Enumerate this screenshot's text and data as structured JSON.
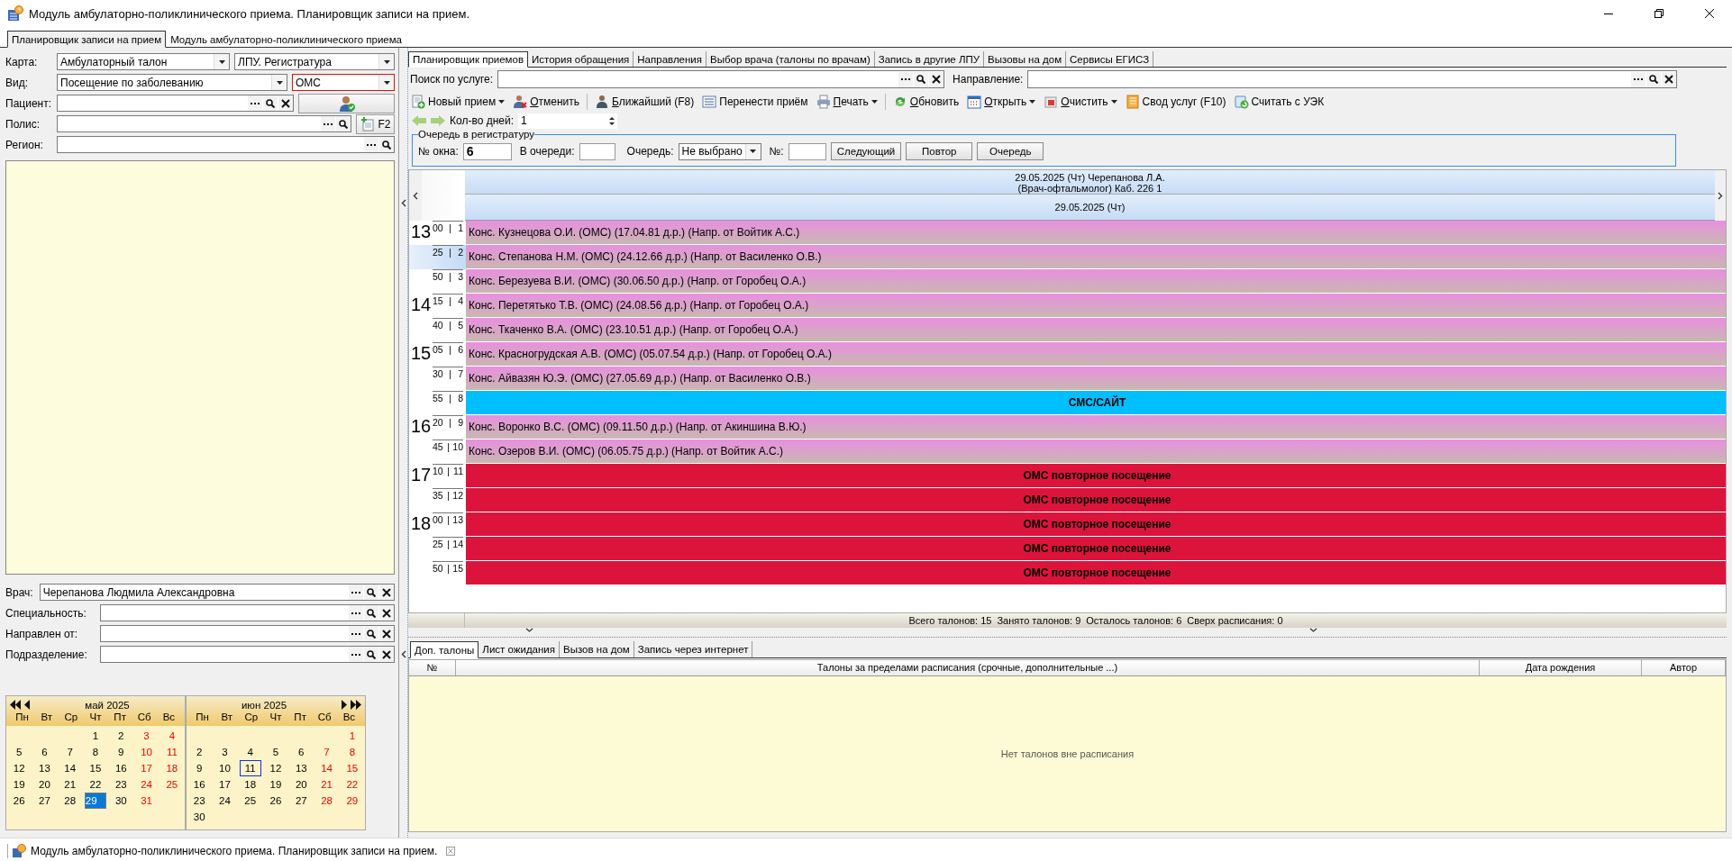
{
  "window": {
    "title": "Модуль амбулаторно-поликлинического приема. Планировщик записи на прием."
  },
  "module_tabs": [
    {
      "label": "Планировщик записи на прием",
      "selected": true
    },
    {
      "label": "Модуль амбулаторно-поликлинического приема",
      "selected": false
    }
  ],
  "patient_form": {
    "rows": [
      {
        "label": "Карта:",
        "items": [
          {
            "kind": "select",
            "value": "Амбулаторный талон",
            "highlighted": false
          },
          {
            "kind": "select",
            "value": "ЛПУ. Регистратура",
            "highlighted": false
          }
        ]
      },
      {
        "label": "Вид:",
        "items": [
          {
            "kind": "select",
            "value": "Посещение по заболеванию",
            "highlighted": false
          },
          {
            "kind": "select",
            "value": "ОМС",
            "highlighted": true
          }
        ]
      },
      {
        "label": "Пациент:",
        "items": [
          {
            "kind": "lookup",
            "clearable": true
          },
          {
            "kind": "patient_button"
          }
        ]
      },
      {
        "label": "Полис:",
        "items": [
          {
            "kind": "lookup",
            "clearable": false
          },
          {
            "kind": "new_button",
            "label": "F2"
          }
        ]
      },
      {
        "label": "Регион:",
        "items": [
          {
            "kind": "lookup",
            "clearable": false
          }
        ]
      }
    ]
  },
  "doctor_form": {
    "rows": [
      {
        "label": "Врач:",
        "value": "Черепанова Людмила Александровна"
      },
      {
        "label": "Специальность:"
      },
      {
        "label": "Направлен от:"
      },
      {
        "label": "Подразделение:"
      }
    ]
  },
  "calendar": {
    "months": [
      {
        "title": "май 2025",
        "weekdays": [
          "Пн",
          "Вт",
          "Ср",
          "Чт",
          "Пт",
          "Сб",
          "Вс"
        ],
        "weeks": [
          [
            {
              "d": "1",
              "weekend": false,
              "selected": false,
              "today": false
            },
            {
              "d": "2",
              "weekend": false,
              "selected": false,
              "today": false
            },
            {
              "d": "3",
              "weekend": true,
              "selected": false,
              "today": false
            },
            {
              "d": "4",
              "weekend": true,
              "selected": false,
              "today": false
            }
          ],
          [
            {
              "d": "5",
              "weekend": false,
              "selected": false,
              "today": false
            },
            {
              "d": "6",
              "weekend": false,
              "selected": false,
              "today": false
            },
            {
              "d": "7",
              "weekend": false,
              "selected": false,
              "today": false
            },
            {
              "d": "8",
              "weekend": false,
              "selected": false,
              "today": false
            },
            {
              "d": "9",
              "weekend": false,
              "selected": false,
              "today": false
            },
            {
              "d": "10",
              "weekend": true,
              "selected": false,
              "today": false
            },
            {
              "d": "11",
              "weekend": true,
              "selected": false,
              "today": false
            }
          ],
          [
            {
              "d": "12",
              "weekend": false,
              "selected": false,
              "today": false
            },
            {
              "d": "13",
              "weekend": false,
              "selected": false,
              "today": false
            },
            {
              "d": "14",
              "weekend": false,
              "selected": false,
              "today": false
            },
            {
              "d": "15",
              "weekend": false,
              "selected": false,
              "today": false
            },
            {
              "d": "16",
              "weekend": false,
              "selected": false,
              "today": false
            },
            {
              "d": "17",
              "weekend": true,
              "selected": false,
              "today": false
            },
            {
              "d": "18",
              "weekend": true,
              "selected": false,
              "today": false
            }
          ],
          [
            {
              "d": "19",
              "weekend": false,
              "selected": false,
              "today": false
            },
            {
              "d": "20",
              "weekend": false,
              "selected": false,
              "today": false
            },
            {
              "d": "21",
              "weekend": false,
              "selected": false,
              "today": false
            },
            {
              "d": "22",
              "weekend": false,
              "selected": false,
              "today": false
            },
            {
              "d": "23",
              "weekend": false,
              "selected": false,
              "today": false
            },
            {
              "d": "24",
              "weekend": true,
              "selected": false,
              "today": false
            },
            {
              "d": "25",
              "weekend": true,
              "selected": false,
              "today": false
            }
          ],
          [
            {
              "d": "26",
              "weekend": false,
              "selected": false,
              "today": false
            },
            {
              "d": "27",
              "weekend": false,
              "selected": false,
              "today": false
            },
            {
              "d": "28",
              "weekend": false,
              "selected": false,
              "today": false
            },
            {
              "d": "29",
              "weekend": false,
              "selected": true,
              "today": false
            },
            {
              "d": "30",
              "weekend": false,
              "selected": false,
              "today": false
            },
            {
              "d": "31",
              "weekend": true,
              "selected": false,
              "today": false
            }
          ]
        ]
      },
      {
        "title": "июн 2025",
        "weekdays": [
          "Пн",
          "Вт",
          "Ср",
          "Чт",
          "Пт",
          "Сб",
          "Вс"
        ],
        "weeks": [
          [
            {
              "d": "1",
              "weekend": true,
              "selected": false,
              "today": false
            }
          ],
          [
            {
              "d": "2",
              "weekend": false,
              "selected": false,
              "today": false
            },
            {
              "d": "3",
              "weekend": false,
              "selected": false,
              "today": false
            },
            {
              "d": "4",
              "weekend": false,
              "selected": false,
              "today": false
            },
            {
              "d": "5",
              "weekend": false,
              "selected": false,
              "today": false
            },
            {
              "d": "6",
              "weekend": false,
              "selected": false,
              "today": false
            },
            {
              "d": "7",
              "weekend": true,
              "selected": false,
              "today": false
            },
            {
              "d": "8",
              "weekend": true,
              "selected": false,
              "today": false
            }
          ],
          [
            {
              "d": "9",
              "weekend": false,
              "selected": false,
              "today": false
            },
            {
              "d": "10",
              "weekend": false,
              "selected": false,
              "today": false
            },
            {
              "d": "11",
              "weekend": false,
              "selected": false,
              "today": true
            },
            {
              "d": "12",
              "weekend": false,
              "selected": false,
              "today": false
            },
            {
              "d": "13",
              "weekend": false,
              "selected": false,
              "today": false
            },
            {
              "d": "14",
              "weekend": true,
              "selected": false,
              "today": false
            },
            {
              "d": "15",
              "weekend": true,
              "selected": false,
              "today": false
            }
          ],
          [
            {
              "d": "16",
              "weekend": false,
              "selected": false,
              "today": false
            },
            {
              "d": "17",
              "weekend": false,
              "selected": false,
              "today": false
            },
            {
              "d": "18",
              "weekend": false,
              "selected": false,
              "today": false
            },
            {
              "d": "19",
              "weekend": false,
              "selected": false,
              "today": false
            },
            {
              "d": "20",
              "weekend": false,
              "selected": false,
              "today": false
            },
            {
              "d": "21",
              "weekend": true,
              "selected": false,
              "today": false
            },
            {
              "d": "22",
              "weekend": true,
              "selected": false,
              "today": false
            }
          ],
          [
            {
              "d": "23",
              "weekend": false,
              "selected": false,
              "today": false
            },
            {
              "d": "24",
              "weekend": false,
              "selected": false,
              "today": false
            },
            {
              "d": "25",
              "weekend": false,
              "selected": false,
              "today": false
            },
            {
              "d": "26",
              "weekend": false,
              "selected": false,
              "today": false
            },
            {
              "d": "27",
              "weekend": false,
              "selected": false,
              "today": false
            },
            {
              "d": "28",
              "weekend": true,
              "selected": false,
              "today": false
            },
            {
              "d": "29",
              "weekend": true,
              "selected": false,
              "today": false
            }
          ],
          [
            {
              "d": "30",
              "weekend": false,
              "selected": false,
              "today": false
            }
          ]
        ]
      }
    ]
  },
  "tabs": [
    {
      "label": "Планировщик приемов",
      "selected": true
    },
    {
      "label": "История обращения",
      "selected": false
    },
    {
      "label": "Направления",
      "selected": false
    },
    {
      "label": "Выбор врача (талоны по врачам)",
      "selected": false
    },
    {
      "label": "Запись в другие ЛПУ",
      "selected": false
    },
    {
      "label": "Вызовы на дом",
      "selected": false
    },
    {
      "label": "Сервисы ЕГИСЗ",
      "selected": false
    }
  ],
  "search": {
    "service_label": "Поиск по услуге:",
    "referral_label": "Направление:"
  },
  "toolbar": [
    [
      {
        "label": "Новый прием",
        "dropdown": true,
        "hotkey": false
      },
      {
        "label": "Отменить",
        "dropdown": false,
        "hotkey": true
      }
    ],
    [
      {
        "label": "Ближайший (F8)",
        "dropdown": false,
        "hotkey": true
      },
      {
        "label": "Перенести приём",
        "dropdown": false,
        "hotkey": false
      },
      {
        "label": "Печать",
        "dropdown": true,
        "hotkey": true
      }
    ],
    [
      {
        "label": "Обновить",
        "dropdown": false,
        "hotkey": true
      },
      {
        "label": "Открыть",
        "dropdown": true,
        "hotkey": true
      },
      {
        "label": "Очистить",
        "dropdown": true,
        "hotkey": true
      },
      {
        "label": "Свод услуг (F10)",
        "dropdown": false,
        "hotkey": false
      },
      {
        "label": "Считать с УЭК",
        "dropdown": false,
        "hotkey": false
      }
    ]
  ],
  "days": {
    "label": "Кол-во дней:",
    "value": "1"
  },
  "queue": {
    "legend": "Очередь в регистратуру",
    "window_label": "№ окна:",
    "window_value": "6",
    "in_queue_label": "В очереди:",
    "queue_label": "Очередь:",
    "queue_value": "Не выбрано",
    "number_label": "№:",
    "buttons": [
      "Следующий",
      "Повтор",
      "Очередь"
    ]
  },
  "schedule": {
    "header": {
      "doctor_line": "29.05.2025 (Чт) Черепанова Л.А.",
      "room_line": "(Врач-офтальмолог) Каб. 226 1",
      "date": "29.05.2025 (Чт)"
    },
    "slots": [
      {
        "hour": "13",
        "minute": "00",
        "number": "1",
        "kind": "booked",
        "text": "Конс. Кузнецова О.И. (ОМС) (17.04.81 д.р.) (Напр. от Войтик А.С.)",
        "selected": false
      },
      {
        "minute": "25",
        "number": "2",
        "kind": "booked",
        "text": "Конс. Степанова Н.М. (ОМС) (24.12.66 д.р.) (Напр. от Василенко О.В.)",
        "selected": true
      },
      {
        "minute": "50",
        "number": "3",
        "kind": "booked",
        "text": "Конс. Березуева В.И. (ОМС) (30.06.50 д.р.) (Напр. от Горобец О.А.)",
        "selected": false
      },
      {
        "hour": "14",
        "minute": "15",
        "number": "4",
        "kind": "booked",
        "text": "Конс. Перетятько Т.В. (ОМС) (24.08.56 д.р.) (Напр. от Горобец О.А.)",
        "selected": false
      },
      {
        "minute": "40",
        "number": "5",
        "kind": "booked",
        "text": "Конс. Ткаченко В.А. (ОМС) (23.10.51 д.р.) (Напр. от Горобец О.А.)",
        "selected": false
      },
      {
        "hour": "15",
        "minute": "05",
        "number": "6",
        "kind": "booked",
        "text": "Конс. Красногрудская А.В. (ОМС) (05.07.54 д.р.) (Напр. от Горобец О.А.)",
        "selected": false
      },
      {
        "minute": "30",
        "number": "7",
        "kind": "booked",
        "text": "Конс. Айвазян Ю.Э. (ОМС) (27.05.69 д.р.) (Напр. от Василенко О.В.)",
        "selected": false
      },
      {
        "minute": "55",
        "number": "8",
        "kind": "site",
        "text": "СМС/САЙТ",
        "selected": false
      },
      {
        "hour": "16",
        "minute": "20",
        "number": "9",
        "kind": "booked",
        "text": "Конс. Воронко В.С. (ОМС) (09.11.50 д.р.) (Напр. от Акиншина В.Ю.)",
        "selected": false
      },
      {
        "minute": "45",
        "number": "10",
        "kind": "booked",
        "text": "Конс. Озеров В.И. (ОМС) (06.05.75 д.р.) (Напр. от Войтик А.С.)",
        "selected": false
      },
      {
        "hour": "17",
        "minute": "10",
        "number": "11",
        "kind": "repeat",
        "text": "ОМС повторное посещение",
        "selected": false
      },
      {
        "minute": "35",
        "number": "12",
        "kind": "repeat",
        "text": "ОМС повторное посещение",
        "selected": false
      },
      {
        "hour": "18",
        "minute": "00",
        "number": "13",
        "kind": "repeat",
        "text": "ОМС повторное посещение",
        "selected": false
      },
      {
        "minute": "25",
        "number": "14",
        "kind": "repeat",
        "text": "ОМС повторное посещение",
        "selected": false
      },
      {
        "minute": "50",
        "number": "15",
        "kind": "repeat",
        "text": "ОМС повторное посещение",
        "selected": false
      }
    ],
    "summary": [
      "Всего талонов: 15",
      "Занято талонов: 9",
      "Осталось талонов: 6",
      "Сверх расписания: 0"
    ]
  },
  "extra": {
    "tabs": [
      {
        "label": "Доп. талоны",
        "selected": true
      },
      {
        "label": "Лист ожидания",
        "selected": false
      },
      {
        "label": "Вызов на дом",
        "selected": false
      },
      {
        "label": "Запись через интернет",
        "selected": false
      }
    ],
    "columns": [
      "№",
      "Талоны за пределами расписания (срочные, дополнительные ...)",
      "Дата рождения",
      "Автор"
    ],
    "empty_text": "Нет талонов вне расписания"
  },
  "taskbar": {
    "title": "Модуль амбулаторно-поликлинического приема. Планировщик записи на прием."
  }
}
